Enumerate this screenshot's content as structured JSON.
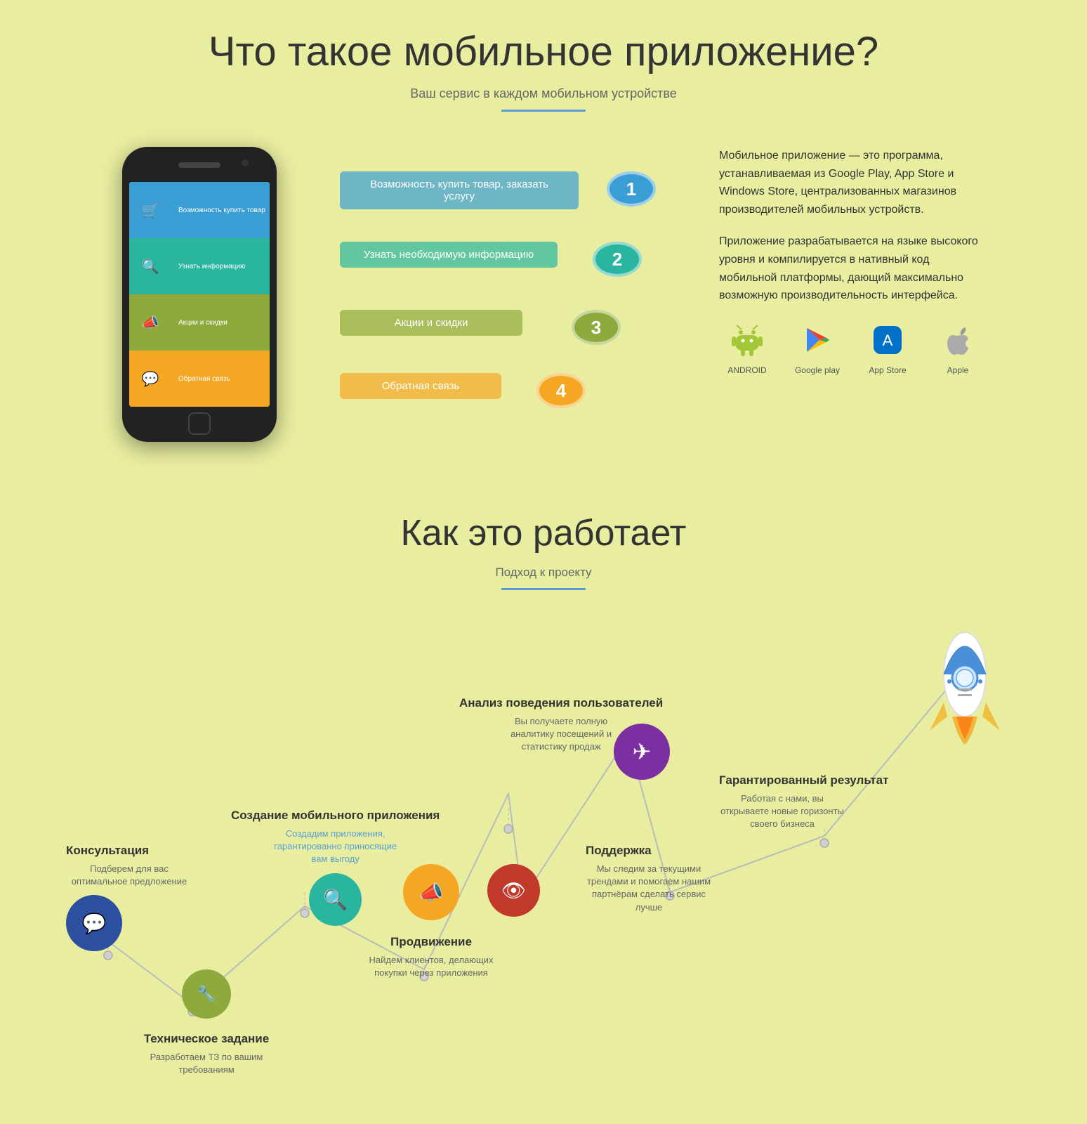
{
  "section1": {
    "title": "Что такое мобильное приложение?",
    "subtitle": "Ваш сервис в каждом мобильном устройстве",
    "phone": {
      "rows": [
        {
          "icon": "🛒",
          "label": "Возможность купить товар, заказать услугу",
          "num": "1",
          "color": "row-blue"
        },
        {
          "icon": "🔍",
          "label": "Узнать необходимую информацию",
          "num": "2",
          "color": "row-teal"
        },
        {
          "icon": "📣",
          "label": "Акции и скидки",
          "num": "3",
          "color": "row-olive"
        },
        {
          "icon": "💬",
          "label": "Обратная связь",
          "num": "4",
          "color": "row-orange"
        }
      ]
    },
    "description": {
      "p1": "Мобильное приложение — это программа, устанавливаемая из Google Play, App Store и Windows Store, централизованных магазинов производителей мобильных устройств.",
      "p2": "Приложение разрабатывается на языке высокого уровня и компилируется в нативный код мобильной платформы, дающий максимально возможную производительность интерфейса."
    },
    "stores": [
      {
        "name": "android-store",
        "label": "ANDROID",
        "icon": "🤖"
      },
      {
        "name": "google-play-store",
        "label": "Google play",
        "icon": "▶"
      },
      {
        "name": "app-store",
        "label": "App Store",
        "icon": "🅰"
      },
      {
        "name": "apple-store",
        "label": "Apple",
        "icon": ""
      }
    ]
  },
  "section2": {
    "title": "Как это работает",
    "subtitle": "Подход к проекту",
    "nodes": [
      {
        "id": "consultation",
        "title": "Консультация",
        "desc": "Подберем для вас оптимальное предложение",
        "icon": "💬",
        "color": "c-darkblue"
      },
      {
        "id": "technical",
        "title": "Техническое задание",
        "desc": "Разработаем ТЗ по вашим требованиям",
        "icon": "🔧",
        "color": "c-green"
      },
      {
        "id": "creation",
        "title": "Создание мобильного приложения",
        "desc": "Создадим приложения, гарантированно приносящие вам выгоду",
        "icon": "🔍",
        "color": "c-teal"
      },
      {
        "id": "promotion",
        "title": "Продвижение",
        "desc": "Найдем клиентов, делающих покупки через приложения",
        "icon": "📣",
        "color": "c-orange"
      },
      {
        "id": "analysis",
        "title": "Анализ поведения пользователей",
        "desc": "Вы получаете полную аналитику посещений и статистику продаж",
        "icon": "👁",
        "color": "c-red"
      },
      {
        "id": "support",
        "title": "Поддержка",
        "desc": "Мы следим за текущими трендами и помогаем нашим партнёрам сделать сервис лучше",
        "icon": "✈",
        "color": "c-purple"
      },
      {
        "id": "result",
        "title": "Гарантированный результат",
        "desc": "Работая с нами, вы открываете новые горизонты своего бизнеса",
        "icon": "🚀",
        "color": "c-darkpurple"
      }
    ]
  }
}
